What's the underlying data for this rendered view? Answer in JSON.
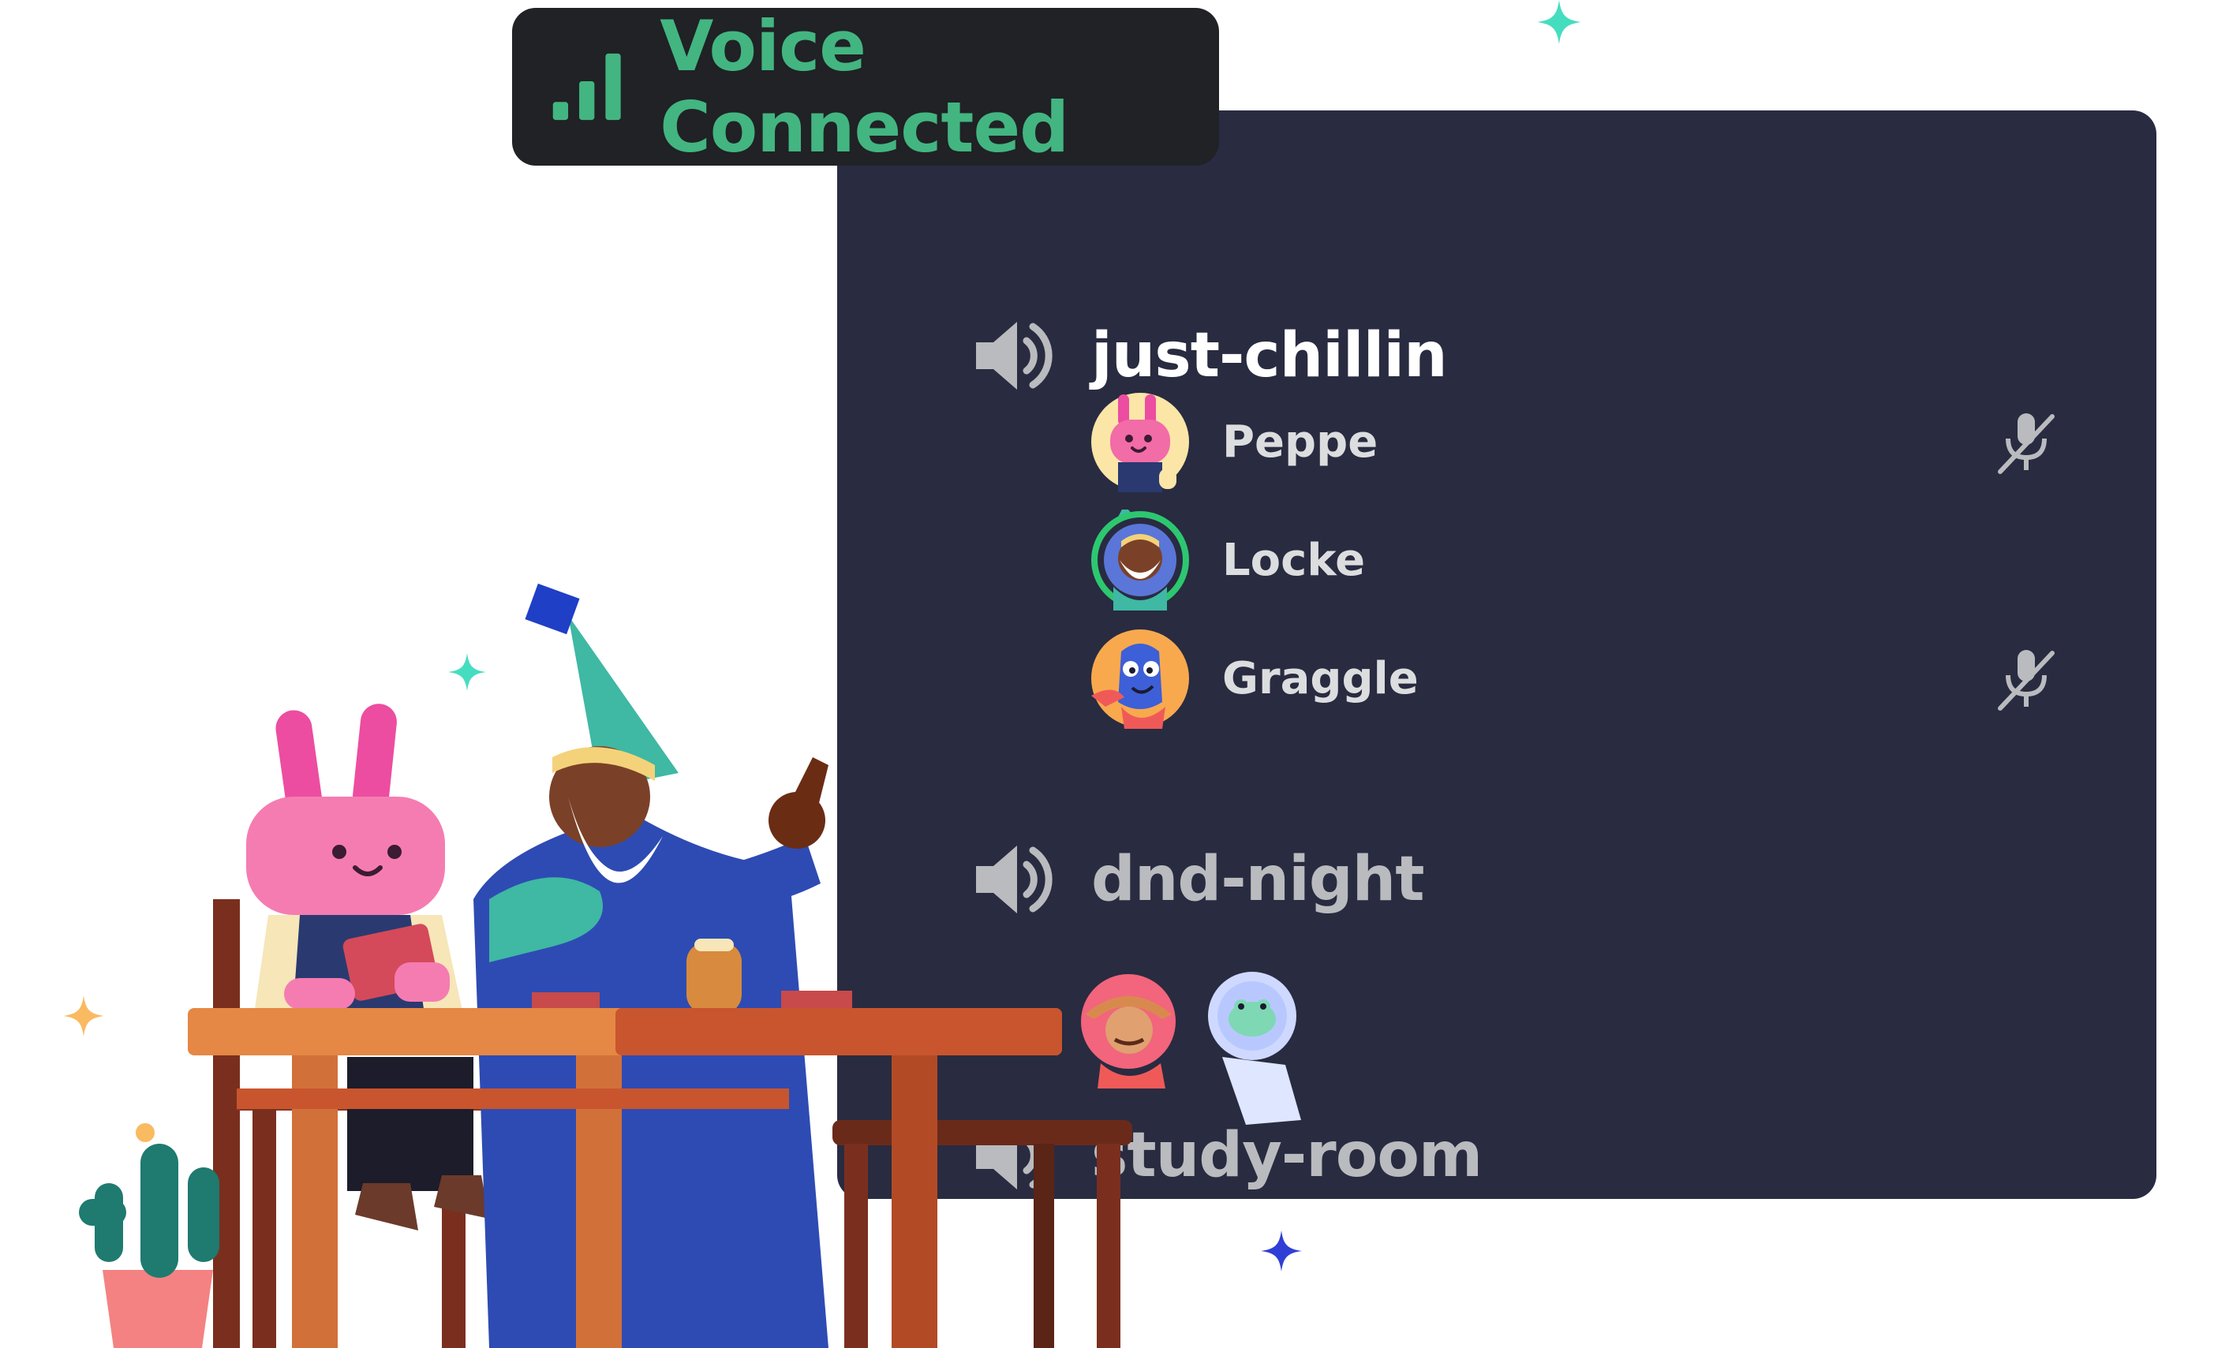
{
  "voice_status": {
    "label": "Voice Connected",
    "icon": "signal-bars-icon",
    "color": "#43b581"
  },
  "panel": {
    "background": "#292b41",
    "channels": [
      {
        "name": "just-chillin",
        "icon": "speaker-icon",
        "state": "active",
        "members": [
          {
            "name": "Peppe",
            "avatar": "bunny-avatar",
            "muted": true
          },
          {
            "name": "Locke",
            "avatar": "wizard-avatar",
            "muted": false,
            "speaking": true
          },
          {
            "name": "Graggle",
            "avatar": "blue-creature-avatar",
            "muted": true
          }
        ]
      },
      {
        "name": "dnd-night",
        "icon": "speaker-icon",
        "state": "inactive",
        "avatars": [
          "bearded-hat-avatar",
          "frog-astronaut-avatar"
        ]
      },
      {
        "name": "study-room",
        "icon": "speaker-icon",
        "state": "inactive"
      }
    ]
  },
  "colors": {
    "speaking_ring": "#2dc770",
    "muted_icon": "#b9bbbe",
    "panel": "#292b41",
    "pill": "#202225"
  }
}
